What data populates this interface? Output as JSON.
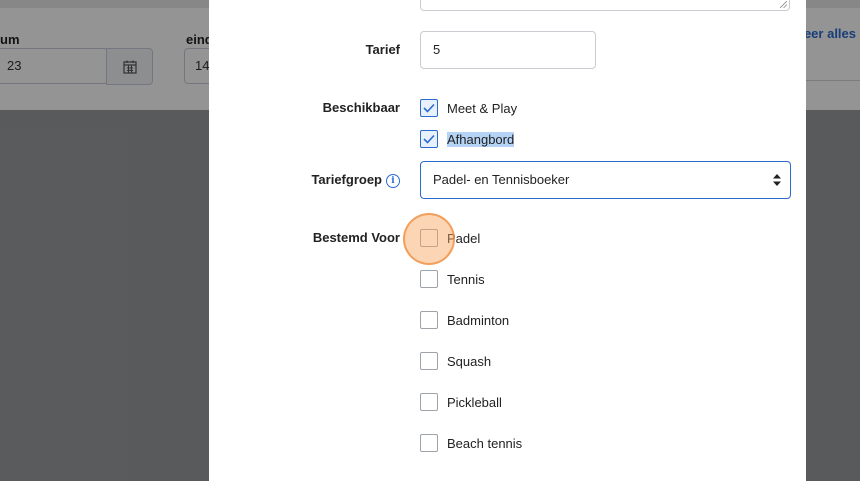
{
  "background": {
    "date_label_partial": "um",
    "date_value_partial": "23",
    "end_label_partial": "eind",
    "end_value_partial": "14",
    "link_partial": "teer alles"
  },
  "modal": {
    "tarief": {
      "label": "Tarief",
      "value": "5"
    },
    "beschikbaar": {
      "label": "Beschikbaar",
      "options": [
        {
          "label": "Meet & Play",
          "checked": true
        },
        {
          "label": "Afhangbord",
          "checked": true,
          "selected_text": true
        }
      ]
    },
    "tariefgroep": {
      "label": "Tariefgroep",
      "info_icon": "info-icon",
      "selected": "Padel- en Tennisboeker"
    },
    "bestemd_voor": {
      "label": "Bestemd Voor",
      "options": [
        {
          "label": "Padel",
          "checked": false
        },
        {
          "label": "Tennis",
          "checked": false
        },
        {
          "label": "Badminton",
          "checked": false
        },
        {
          "label": "Squash",
          "checked": false
        },
        {
          "label": "Pickleball",
          "checked": false
        },
        {
          "label": "Beach tennis",
          "checked": false
        }
      ]
    }
  },
  "colors": {
    "accent": "#2a6bd1",
    "click_indicator": "#f7a159"
  }
}
